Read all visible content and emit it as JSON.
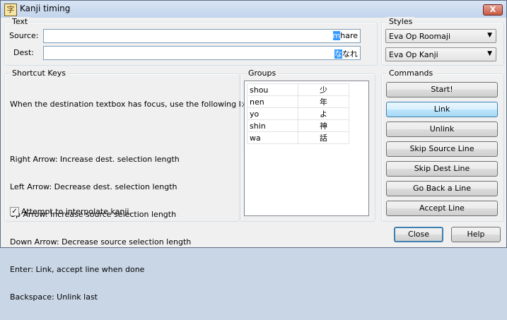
{
  "window": {
    "title": "Kanji timing",
    "icon": "kanji-app-icon",
    "close_glyph": "X"
  },
  "text_group": {
    "label": "Text",
    "source_label": "Source:",
    "source_selected": "m",
    "source_rest": "hare",
    "dest_label": "Dest:",
    "dest_selected": "な",
    "dest_rest": "なれ"
  },
  "styles_group": {
    "label": "Styles",
    "source_style": "Eva Op Roomaji",
    "dest_style": "Eva Op Kanji"
  },
  "shortcuts_group": {
    "label": "Shortcut Keys",
    "lines": [
      "When the destination textbox has focus, use the following keys:",
      "",
      "Right Arrow: Increase dest. selection length",
      "Left Arrow: Decrease dest. selection length",
      "Up Arrow: Increase source selection length",
      "Down Arrow: Decrease source selection length",
      "Enter: Link, accept line when done",
      "Backspace: Unlink last"
    ],
    "interpolate_checked": true,
    "interpolate_label": "Attempt to interpolate kanji."
  },
  "groups_group": {
    "label": "Groups",
    "rows": [
      {
        "source": "shou",
        "dest": "少"
      },
      {
        "source": "nen",
        "dest": "年"
      },
      {
        "source": "yo",
        "dest": "よ"
      },
      {
        "source": "shin",
        "dest": "神"
      },
      {
        "source": "wa",
        "dest": "話"
      }
    ]
  },
  "commands_group": {
    "label": "Commands",
    "start": "Start!",
    "link": "Link",
    "unlink": "Unlink",
    "skip_source": "Skip Source Line",
    "skip_dest": "Skip Dest Line",
    "go_back": "Go Back a Line",
    "accept": "Accept Line"
  },
  "footer": {
    "close": "Close",
    "help": "Help"
  }
}
